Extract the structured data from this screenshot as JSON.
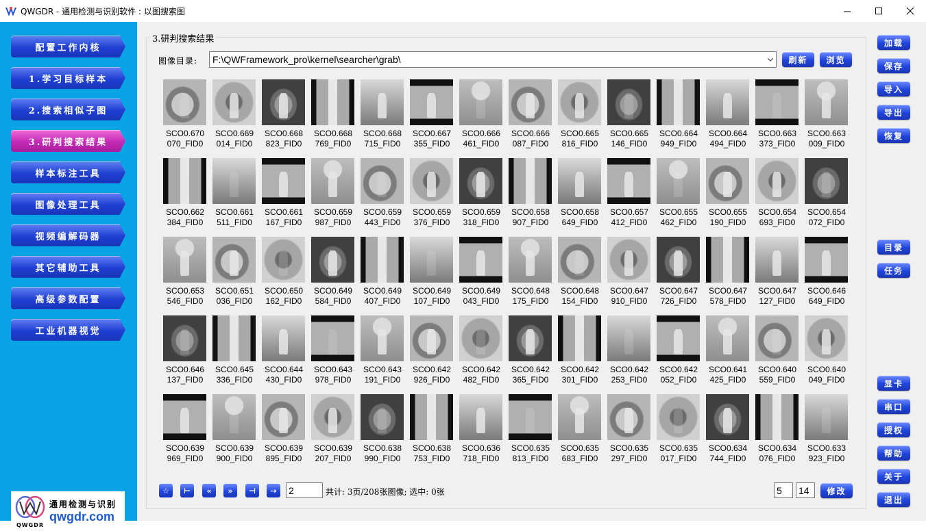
{
  "window": {
    "title": "QWGDR - 通用检测与识别软件 : 以图搜索图"
  },
  "sidebar": {
    "items": [
      {
        "label": "配置工作内核",
        "active": false
      },
      {
        "label": "1.学习目标样本",
        "active": false
      },
      {
        "label": "2.搜索相似子图",
        "active": false
      },
      {
        "label": "3.研判搜索结果",
        "active": true
      },
      {
        "label": "样本标注工具",
        "active": false
      },
      {
        "label": "图像处理工具",
        "active": false
      },
      {
        "label": "视频编解码器",
        "active": false
      },
      {
        "label": "其它辅助工具",
        "active": false
      },
      {
        "label": "高级参数配置",
        "active": false
      },
      {
        "label": "工业机器视觉",
        "active": false
      }
    ],
    "logo": {
      "brand_name": "通用检测与识别",
      "site": "qwgdr.com",
      "mark": "QWGDR"
    }
  },
  "main": {
    "group_title": "3.研判搜索结果",
    "dir_label": "图像目录:",
    "dir_value": "F:\\QWFramework_pro\\kernel\\searcher\\grab\\",
    "refresh_label": "刷新",
    "browse_label": "浏览",
    "results": [
      [
        "SCO0.670",
        "070_FID0"
      ],
      [
        "SCO0.669",
        "014_FID0"
      ],
      [
        "SCO0.668",
        "823_FID0"
      ],
      [
        "SCO0.668",
        "769_FID0"
      ],
      [
        "SCO0.668",
        "715_FID0"
      ],
      [
        "SCO0.667",
        "355_FID0"
      ],
      [
        "SCO0.666",
        "461_FID0"
      ],
      [
        "SCO0.666",
        "087_FID0"
      ],
      [
        "SCO0.665",
        "816_FID0"
      ],
      [
        "SCO0.665",
        "146_FID0"
      ],
      [
        "SCO0.664",
        "949_FID0"
      ],
      [
        "SCO0.664",
        "494_FID0"
      ],
      [
        "SCO0.663",
        "373_FID0"
      ],
      [
        "SCO0.663",
        "009_FID0"
      ],
      [
        "SCO0.662",
        "384_FID0"
      ],
      [
        "SCO0.661",
        "511_FID0"
      ],
      [
        "SCO0.661",
        "167_FID0"
      ],
      [
        "SCO0.659",
        "987_FID0"
      ],
      [
        "SCO0.659",
        "443_FID0"
      ],
      [
        "SCO0.659",
        "376_FID0"
      ],
      [
        "SCO0.659",
        "318_FID0"
      ],
      [
        "SCO0.658",
        "907_FID0"
      ],
      [
        "SCO0.658",
        "649_FID0"
      ],
      [
        "SCO0.657",
        "412_FID0"
      ],
      [
        "SCO0.655",
        "462_FID0"
      ],
      [
        "SCO0.655",
        "190_FID0"
      ],
      [
        "SCO0.654",
        "693_FID0"
      ],
      [
        "SCO0.654",
        "072_FID0"
      ],
      [
        "SCO0.653",
        "546_FID0"
      ],
      [
        "SCO0.651",
        "036_FID0"
      ],
      [
        "SCO0.650",
        "162_FID0"
      ],
      [
        "SCO0.649",
        "584_FID0"
      ],
      [
        "SCO0.649",
        "407_FID0"
      ],
      [
        "SCO0.649",
        "107_FID0"
      ],
      [
        "SCO0.649",
        "043_FID0"
      ],
      [
        "SCO0.648",
        "175_FID0"
      ],
      [
        "SCO0.648",
        "154_FID0"
      ],
      [
        "SCO0.647",
        "910_FID0"
      ],
      [
        "SCO0.647",
        "726_FID0"
      ],
      [
        "SCO0.647",
        "578_FID0"
      ],
      [
        "SCO0.647",
        "127_FID0"
      ],
      [
        "SCO0.646",
        "649_FID0"
      ],
      [
        "SCO0.646",
        "137_FID0"
      ],
      [
        "SCO0.645",
        "336_FID0"
      ],
      [
        "SCO0.644",
        "430_FID0"
      ],
      [
        "SCO0.643",
        "978_FID0"
      ],
      [
        "SCO0.643",
        "191_FID0"
      ],
      [
        "SCO0.642",
        "926_FID0"
      ],
      [
        "SCO0.642",
        "482_FID0"
      ],
      [
        "SCO0.642",
        "365_FID0"
      ],
      [
        "SCO0.642",
        "301_FID0"
      ],
      [
        "SCO0.642",
        "253_FID0"
      ],
      [
        "SCO0.642",
        "052_FID0"
      ],
      [
        "SCO0.641",
        "425_FID0"
      ],
      [
        "SCO0.640",
        "559_FID0"
      ],
      [
        "SCO0.640",
        "049_FID0"
      ],
      [
        "SCO0.639",
        "969_FID0"
      ],
      [
        "SCO0.639",
        "900_FID0"
      ],
      [
        "SCO0.639",
        "895_FID0"
      ],
      [
        "SCO0.639",
        "207_FID0"
      ],
      [
        "SCO0.638",
        "990_FID0"
      ],
      [
        "SCO0.638",
        "753_FID0"
      ],
      [
        "SCO0.636",
        "718_FID0"
      ],
      [
        "SCO0.635",
        "813_FID0"
      ],
      [
        "SCO0.635",
        "683_FID0"
      ],
      [
        "SCO0.635",
        "297_FID0"
      ],
      [
        "SCO0.635",
        "017_FID0"
      ],
      [
        "SCO0.634",
        "744_FID0"
      ],
      [
        "SCO0.634",
        "076_FID0"
      ],
      [
        "SCO0.633",
        "923_FID0"
      ]
    ],
    "pager": {
      "icons": [
        "star-icon",
        "first-page-icon",
        "prev-page-icon",
        "next-page-icon",
        "last-page-icon",
        "goto-icon"
      ],
      "glyphs": [
        "☆",
        "⊢",
        "«",
        "»",
        "⊣",
        "→"
      ],
      "page_value": "2",
      "status": "共计: 3页/208张图像; 选中: 0张",
      "rows_value": "5",
      "cols_value": "14",
      "modify_label": "修改"
    }
  },
  "right_buttons": {
    "top": [
      "加载",
      "保存",
      "导入",
      "导出",
      "恢复"
    ],
    "middle": [
      "目录",
      "任务"
    ],
    "bottom": [
      "显卡",
      "串口",
      "授权",
      "帮助",
      "关于",
      "退出"
    ]
  },
  "colors": {
    "sidebar_bg": "#0aa3e5",
    "button_blue": "#2045db",
    "button_active": "#c22ab5"
  }
}
